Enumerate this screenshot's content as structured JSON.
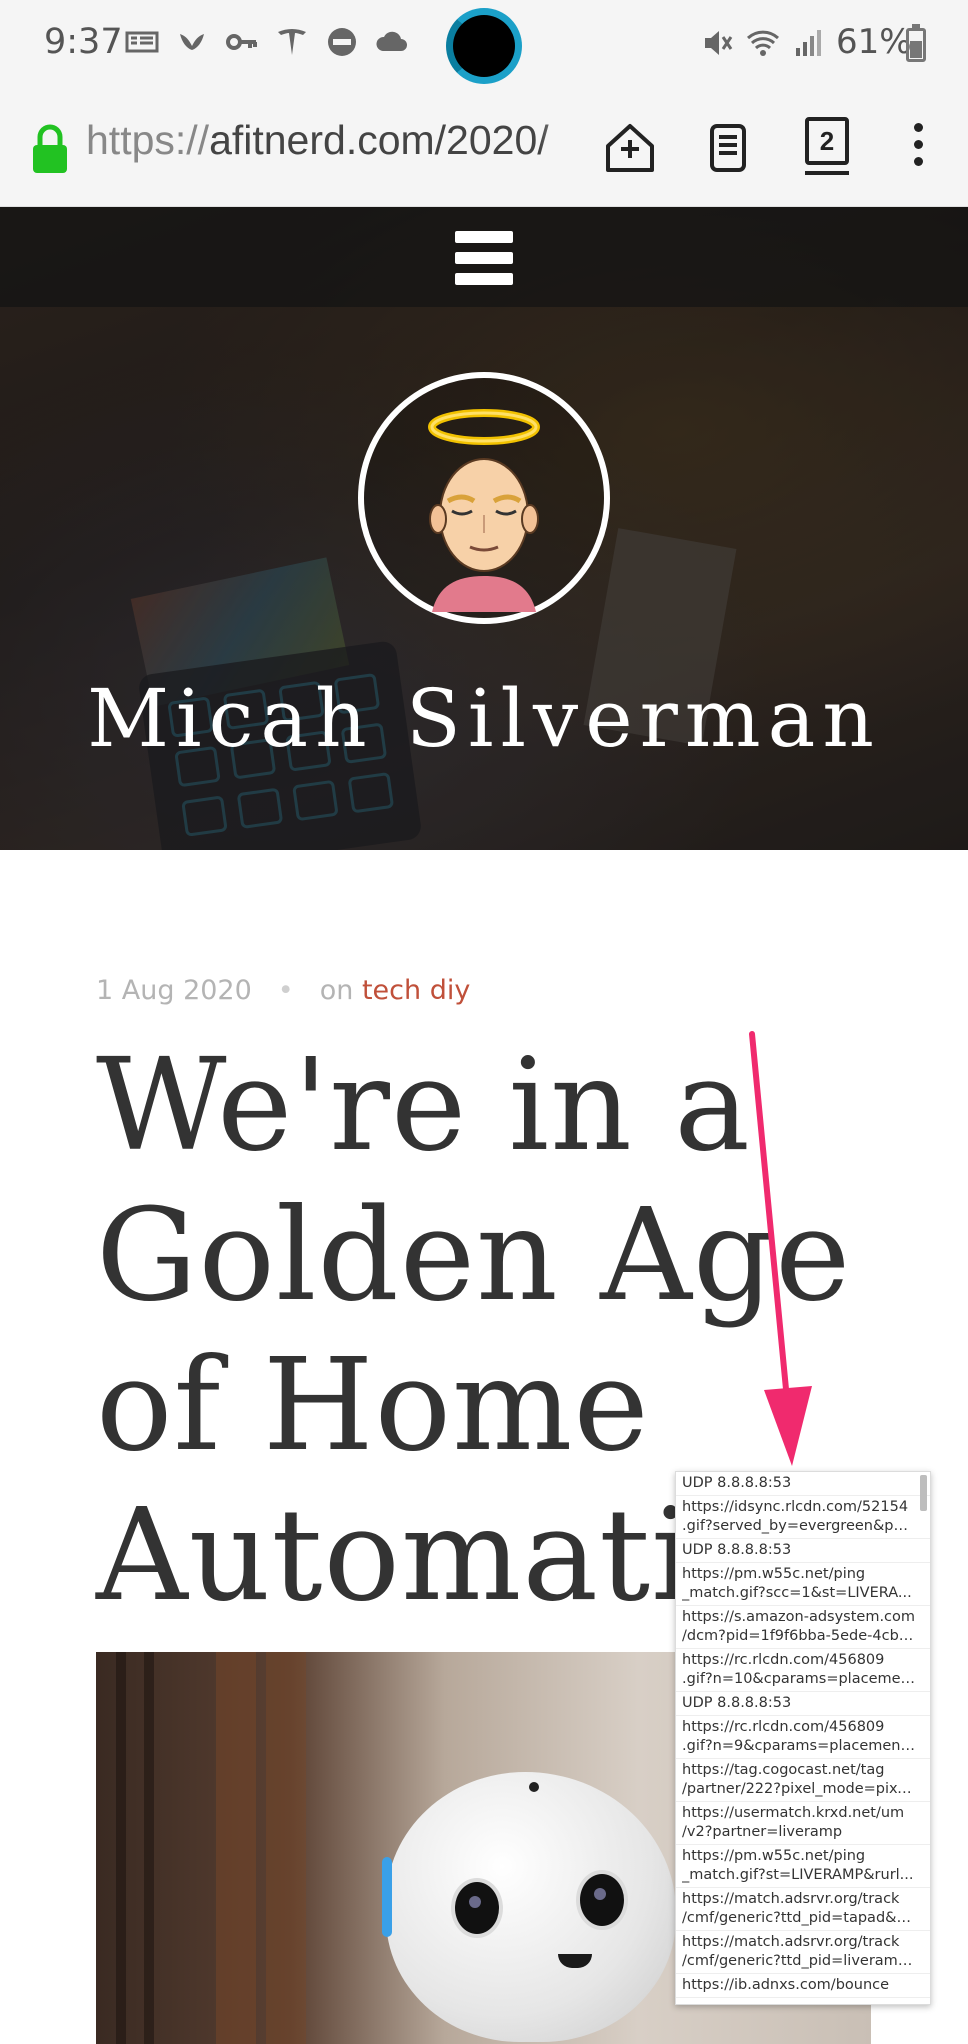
{
  "status_bar": {
    "time": "9:37",
    "battery": "61%",
    "left_icons": [
      "news-icon",
      "bird-icon",
      "key-icon",
      "tesla-icon",
      "do-not-disturb-icon",
      "cloud-icon"
    ],
    "right_icons": [
      "mute-icon",
      "wifi-icon",
      "signal-icon",
      "battery-icon"
    ]
  },
  "browser": {
    "url_scheme": "https://",
    "url_rest": "afitnerd.com/2020/",
    "tab_count": "2"
  },
  "hero": {
    "site_title": "Micah Silverman"
  },
  "article": {
    "date": "1 Aug 2020",
    "separator": "•",
    "on_label": "on",
    "category": "tech diy",
    "title": "We're in a Golden Age of Home Automati"
  },
  "network_log": [
    {
      "lines": [
        "UDP 8.8.8.8:53"
      ]
    },
    {
      "lines": [
        "https://idsync.rlcdn.com/52154",
        ".gif?served_by=evergreen&part..."
      ]
    },
    {
      "lines": [
        "UDP 8.8.8.8:53"
      ]
    },
    {
      "lines": [
        "https://pm.w55c.net/ping",
        "_match.gif?scc=1&st=LIVERA..."
      ]
    },
    {
      "lines": [
        "https://s.amazon-adsystem.com",
        "/dcm?pid=1f9f6bba-5ede-4cb5..."
      ]
    },
    {
      "lines": [
        "https://rc.rlcdn.com/456809",
        ".gif?n=10&cparams=placemen..."
      ]
    },
    {
      "lines": [
        "UDP 8.8.8.8:53"
      ]
    },
    {
      "lines": [
        "https://rc.rlcdn.com/456809",
        ".gif?n=9&cparams=placement..."
      ]
    },
    {
      "lines": [
        "https://tag.cogocast.net/tag",
        "/partner/222?pixel_mode=pixel..."
      ]
    },
    {
      "lines": [
        "https://usermatch.krxd.net/um",
        "/v2?partner=liveramp"
      ]
    },
    {
      "lines": [
        "https://pm.w55c.net/ping",
        "_match.gif?st=LIVERAMP&rurl..."
      ]
    },
    {
      "lines": [
        "https://match.adsrvr.org/track",
        "/cmf/generic?ttd_pid=tapad&tt..."
      ]
    },
    {
      "lines": [
        "https://match.adsrvr.org/track",
        "/cmf/generic?ttd_pid=liveramp..."
      ]
    },
    {
      "lines": [
        "https://ib.adnxs.com/bounce"
      ]
    }
  ],
  "colors": {
    "accent_category": "#c0503a",
    "lock_green": "#22c222",
    "annotation_arrow": "#f02a6e",
    "assistant_ring": "#1ba0c8"
  }
}
